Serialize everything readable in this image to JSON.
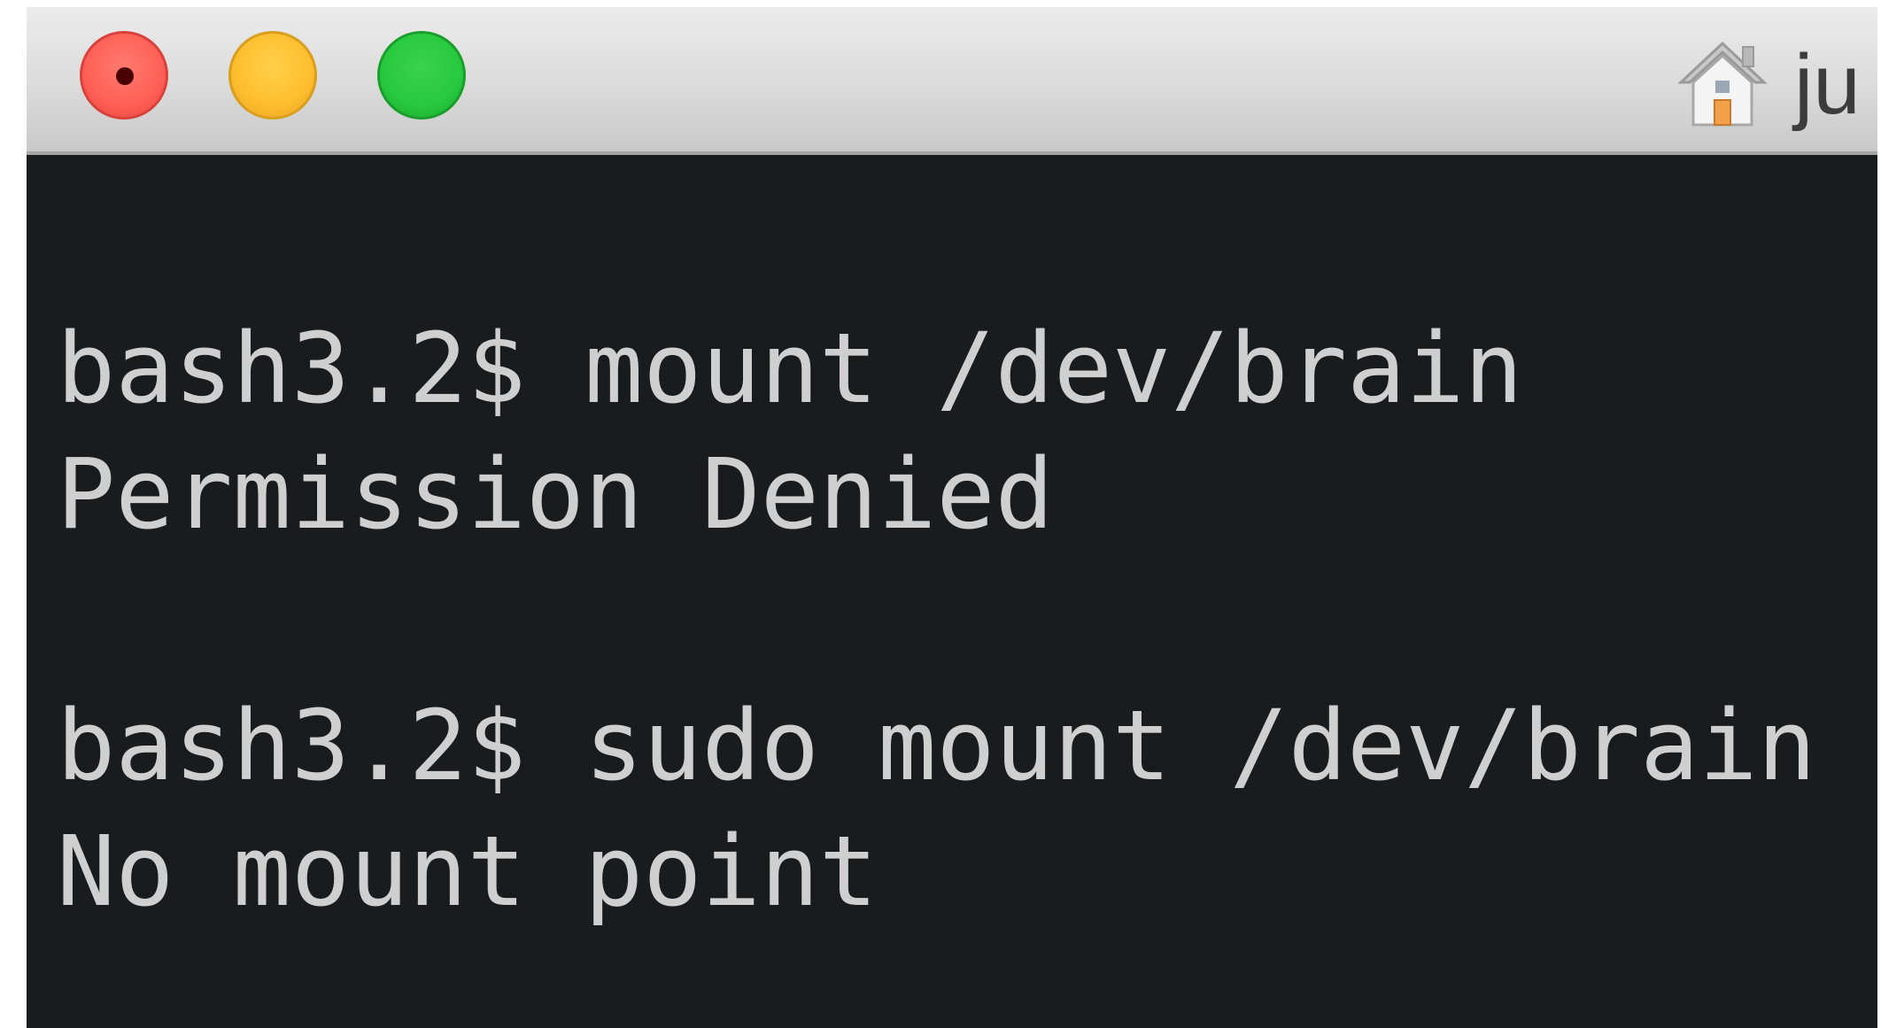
{
  "window": {
    "title": "ju",
    "title_icon": "home-icon",
    "buttons": {
      "close": "close-button",
      "minimize": "minimize-button",
      "zoom": "zoom-button"
    }
  },
  "colors": {
    "terminal_background": "#1a1b1d",
    "terminal_text": "#cfcfcf",
    "close": "#ff5f56",
    "minimize": "#ffbd2e",
    "zoom": "#27c93f"
  },
  "terminal": {
    "lines": [
      "bash3.2$ mount /dev/brain",
      "Permission Denied",
      "",
      "bash3.2$ sudo mount /dev/brain",
      "No mount point"
    ]
  }
}
